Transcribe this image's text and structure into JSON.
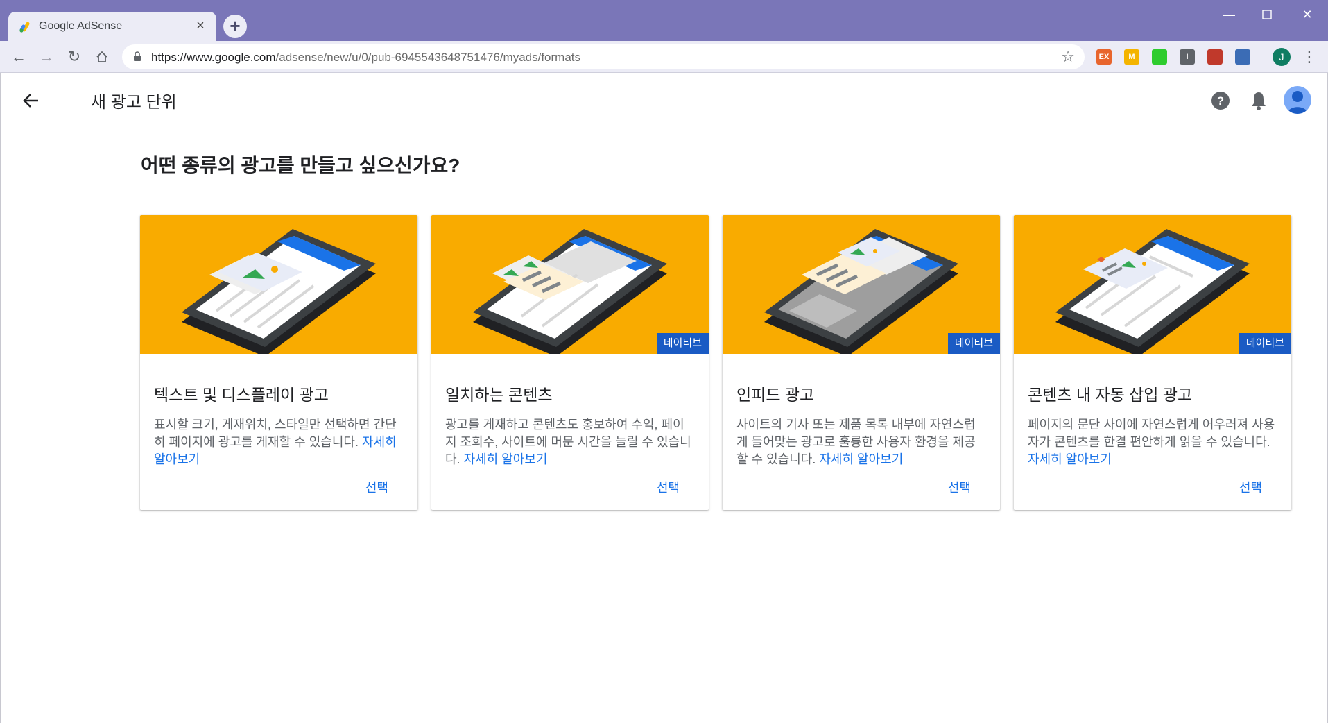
{
  "browser": {
    "tab_title": "Google AdSense",
    "tab_close": "×",
    "new_tab": "+",
    "url_host": "https://www.google.com",
    "url_path": "/adsense/new/u/0/pub-6945543648751476/myads/formats",
    "profile_initial": "J",
    "extensions": [
      {
        "label": "EX",
        "color": "#e8652d"
      },
      {
        "label": "M",
        "color": "#f4b400"
      },
      {
        "label": "",
        "color": "#2ecc2e"
      },
      {
        "label": "I",
        "color": "#5f6368"
      },
      {
        "label": "",
        "color": "#c0392b"
      },
      {
        "label": "",
        "color": "#3b6cb5"
      }
    ]
  },
  "appbar": {
    "title": "새 광고 단위"
  },
  "question": "어떤 종류의 광고를 만들고 싶으신가요?",
  "cards": [
    {
      "title": "텍스트 및 디스플레이 광고",
      "desc": "표시할 크기, 게재위치, 스타일만 선택하면 간단히 페이지에 광고를 게재할 수 있습니다. ",
      "link": "자세히 알아보기",
      "badge": "",
      "select": "선택"
    },
    {
      "title": "일치하는 콘텐츠",
      "desc": "광고를 게재하고 콘텐츠도 홍보하여 수익, 페이지 조회수, 사이트에 머문 시간을 늘릴 수 있습니다. ",
      "link": "자세히 알아보기",
      "badge": "네이티브",
      "select": "선택"
    },
    {
      "title": "인피드 광고",
      "desc": "사이트의 기사 또는 제품 목록 내부에 자연스럽게 들어맞는 광고로 훌륭한 사용자 환경을 제공할 수 있습니다. ",
      "link": "자세히 알아보기",
      "badge": "네이티브",
      "select": "선택"
    },
    {
      "title": "콘텐츠 내 자동 삽입 광고",
      "desc": "페이지의 문단 사이에 자연스럽게 어우러져 사용자가 콘텐츠를 한결 편안하게 읽을 수 있습니다. ",
      "link": "자세히 알아보기",
      "badge": "네이티브",
      "select": "선택"
    }
  ],
  "colors": {
    "hero": "#f9ab00",
    "badge": "#1a5bc4",
    "link": "#1a73e8",
    "chrome": "#7a76b8"
  }
}
